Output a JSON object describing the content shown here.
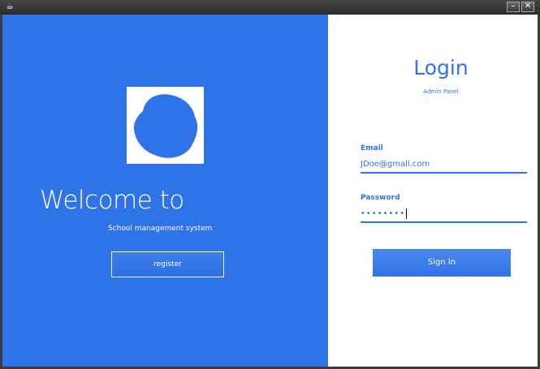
{
  "window": {
    "icon": "app-icon",
    "minimize_label": "–",
    "close_label": "✕"
  },
  "left_panel": {
    "welcome": "Welcome to",
    "subtitle": "School management system",
    "register_label": "register",
    "logo_icon": "white-square-with-blue-blob-logo"
  },
  "right_panel": {
    "title": "Login",
    "subtitle": "Admin Panel",
    "email_label": "Email",
    "email_value": "JDoe@gmall.com",
    "password_label": "Password",
    "password_value": "••••••••",
    "signin_label": "Sign In"
  },
  "colors": {
    "accent": "#2f73e8",
    "panel_background": "#ffffff",
    "titlebar": "#3a3a3a"
  }
}
